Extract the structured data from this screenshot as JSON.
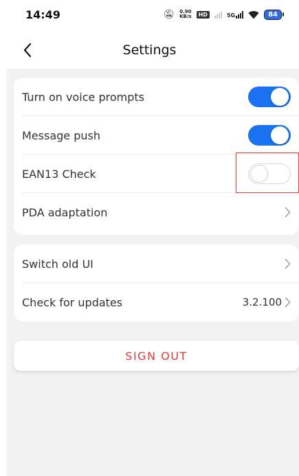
{
  "status_bar": {
    "time": "14:49",
    "speed_value": "0.90",
    "speed_unit": "KB/s",
    "hd_badge": "HD",
    "network_label": "5G",
    "battery_level": "84",
    "icons": [
      "mute-icon",
      "hd-icon",
      "signal-icon",
      "5g-signal-icon",
      "wifi-icon",
      "battery-icon"
    ]
  },
  "header": {
    "title": "Settings",
    "back_icon": "chevron-left-icon"
  },
  "settings_group_1": [
    {
      "label": "Turn on voice prompts",
      "control": "toggle",
      "on": true
    },
    {
      "label": "Message push",
      "control": "toggle",
      "on": true
    },
    {
      "label": "EAN13 Check",
      "control": "toggle",
      "on": false,
      "highlighted": true
    },
    {
      "label": "PDA adaptation",
      "control": "chevron"
    }
  ],
  "settings_group_2": [
    {
      "label": "Switch old UI",
      "control": "chevron"
    },
    {
      "label": "Check for updates",
      "control": "chevron",
      "value": "3.2.100"
    }
  ],
  "sign_out_label": "SIGN OUT",
  "colors": {
    "accent": "#1a72f0",
    "danger": "#e23b3b",
    "background": "#f2f2f2",
    "card": "#ffffff"
  }
}
